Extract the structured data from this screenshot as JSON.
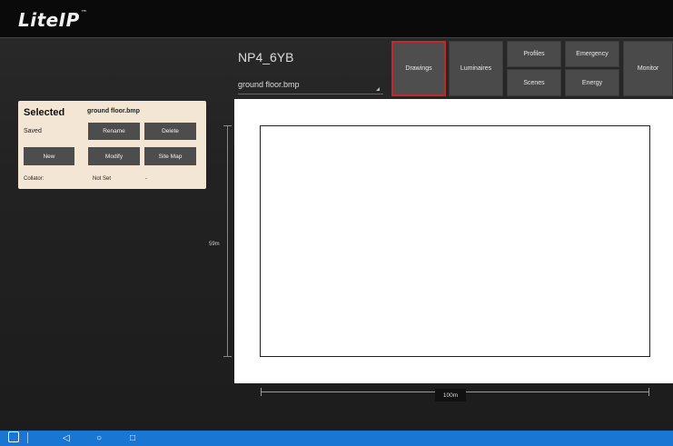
{
  "app": {
    "logo": "LiteIP",
    "logo_mark": "™"
  },
  "project": {
    "name": "NP4_6YB",
    "file": "ground floor.bmp"
  },
  "nav": {
    "drawings": "Drawings",
    "luminaires": "Luminaires",
    "profiles": "Profiles",
    "scenes": "Scenes",
    "emergency": "Emergency",
    "energy": "Energy",
    "monitor": "Monitor",
    "active": "Drawings"
  },
  "panel": {
    "title": "Selected",
    "filename": "ground floor.bmp",
    "status": "Saved",
    "buttons": {
      "rename": "Rename",
      "delete": "Delete",
      "new": "New",
      "modify": "Modify",
      "sitemap": "Site Map"
    },
    "collator_label": "Collator:",
    "collator_value": "Not Set",
    "collator_extra": "-"
  },
  "dimensions": {
    "height": "59m",
    "width": "100m"
  },
  "colors": {
    "active_border": "#c62828",
    "panel_bg": "#f4e6d4",
    "system_bar": "#1976d2"
  },
  "system_bar": {
    "icons": [
      "app-icon",
      "back-icon",
      "home-icon",
      "recents-icon"
    ]
  }
}
